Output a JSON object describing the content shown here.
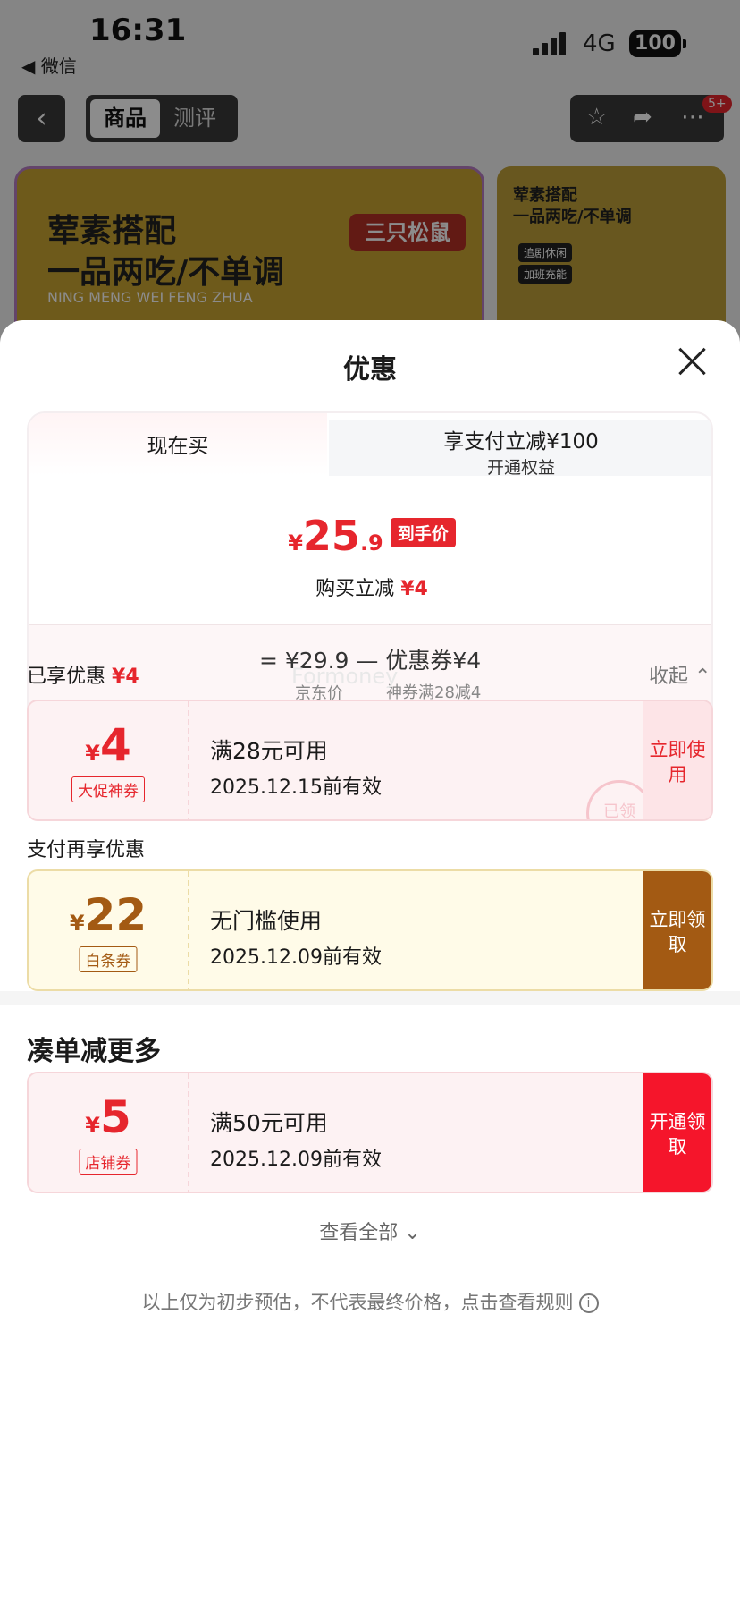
{
  "status_bar": {
    "time": "16:31",
    "back_app": "◀ 微信",
    "network": "4G",
    "battery": "100"
  },
  "nav": {
    "back_icon": "‹",
    "tabs": [
      "商品",
      "测评"
    ],
    "badge": "5+"
  },
  "banner_main": {
    "line1": "荤素搭配",
    "line2": "一品两吃/不单调",
    "en": "NING MENG WEI FENG ZHUA",
    "logo": "三只松鼠"
  },
  "banner_side": {
    "line1": "荤素搭配",
    "line2": "一品两吃/不单调",
    "chip1": "追剧休闲",
    "chip2": "加班充能"
  },
  "sheet": {
    "title": "优惠",
    "tab_now": "现在买",
    "tab_pay_line1": "享支付立减¥100",
    "tab_pay_line2": "开通权益",
    "price_yen": "¥",
    "price_main": "25",
    "price_dec": ".9",
    "price_tag": "到手价",
    "buy_label": "购买立减",
    "buy_amount": "¥4",
    "calc": "=  ¥29.9  —  优惠券¥4",
    "calc_sub1": "京东价",
    "calc_sub2": "神券满28减4",
    "enjoyed_label": "已享优惠",
    "enjoyed_amount": "¥4",
    "collapse": "收起 ⌃",
    "watermark": "Formoney",
    "pay_more_label": "支付再享优惠",
    "more_title": "凑单减更多",
    "view_all": "查看全部 ⌄",
    "note": "以上仅为初步预估，不代表最终价格，点击查看规则",
    "info_icon": "i"
  },
  "coupons": [
    {
      "yen": "¥",
      "amount": "4",
      "label": "大促神券",
      "desc": "满28元可用",
      "date": "2025.12.15前有效",
      "btn": "立即使用",
      "stamp": "已领"
    },
    {
      "yen": "¥",
      "amount": "22",
      "label": "白条券",
      "desc": "无门槛使用",
      "date": "2025.12.09前有效",
      "btn": "立即领取"
    },
    {
      "yen": "¥",
      "amount": "5",
      "label": "店铺券",
      "desc": "满50元可用",
      "date": "2025.12.09前有效",
      "btn": "开通领取"
    }
  ],
  "colors": {
    "accent_red": "#e6262d",
    "brown": "#a35a13",
    "btn_red": "#f5152b"
  }
}
